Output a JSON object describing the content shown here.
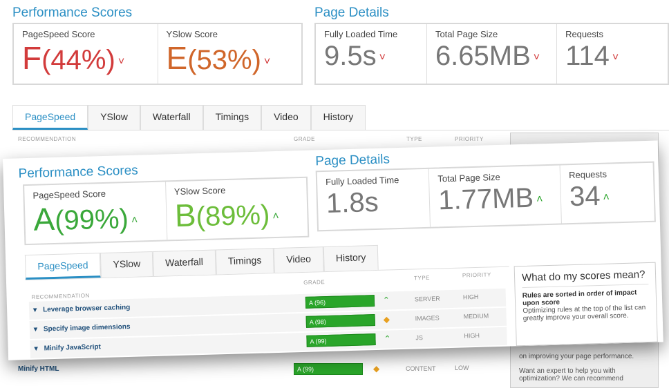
{
  "before": {
    "perf_title": "Performance Scores",
    "details_title": "Page Details",
    "pagespeed": {
      "label": "PageSpeed Score",
      "grade": "F",
      "pct": "(44%)",
      "color": "#d23b3b"
    },
    "yslow": {
      "label": "YSlow Score",
      "grade": "E",
      "pct": "(53%)",
      "color": "#d0662a"
    },
    "loaded": {
      "label": "Fully Loaded Time",
      "value": "9.5s"
    },
    "size": {
      "label": "Total Page Size",
      "value": "6.65MB"
    },
    "requests": {
      "label": "Requests",
      "value": "114"
    },
    "tabs": [
      "PageSpeed",
      "YSlow",
      "Waterfall",
      "Timings",
      "Video",
      "History"
    ],
    "headers": {
      "rec": "RECOMMENDATION",
      "grade": "GRADE",
      "type": "TYPE",
      "priority": "PRIORITY"
    },
    "panel": {
      "line1": "on improving your page performance.",
      "line2": "Want an expert to help you with optimization? We can recommend"
    },
    "rows": [
      {
        "name": "Minify HTML",
        "grade": "A (99)",
        "icon": "diamond-icon",
        "type": "CONTENT",
        "priority": "LOW"
      }
    ]
  },
  "after": {
    "perf_title": "Performance Scores",
    "details_title": "Page Details",
    "pagespeed": {
      "label": "PageSpeed Score",
      "grade": "A",
      "pct": "(99%)",
      "color": "#3aa83a"
    },
    "yslow": {
      "label": "YSlow Score",
      "grade": "B",
      "pct": "(89%)",
      "color": "#6cbd3a"
    },
    "loaded": {
      "label": "Fully Loaded Time",
      "value": "1.8s"
    },
    "size": {
      "label": "Total Page Size",
      "value": "1.77MB"
    },
    "requests": {
      "label": "Requests",
      "value": "34"
    },
    "tabs": [
      "PageSpeed",
      "YSlow",
      "Waterfall",
      "Timings",
      "Video",
      "History"
    ],
    "headers": {
      "rec": "RECOMMENDATION",
      "grade": "GRADE",
      "type": "TYPE",
      "priority": "PRIORITY"
    },
    "rows": [
      {
        "name": "Leverage browser caching",
        "grade": "A (96)",
        "icon": "arrow-up-icon",
        "type": "SERVER",
        "priority": "HIGH"
      },
      {
        "name": "Specify image dimensions",
        "grade": "A (98)",
        "icon": "diamond-icon",
        "type": "IMAGES",
        "priority": "MEDIUM"
      },
      {
        "name": "Minify JavaScript",
        "grade": "A (99)",
        "icon": "arrow-up-icon",
        "type": "JS",
        "priority": "HIGH"
      }
    ],
    "panel": {
      "title": "What do my scores mean?",
      "bold": "Rules are sorted in order of impact upon score",
      "text": "Optimizing rules at the top of the list can greatly improve your overall score."
    }
  },
  "colors": {
    "accent": "#2b8fc4",
    "good": "#2aa52a",
    "bad": "#d23b3b"
  }
}
